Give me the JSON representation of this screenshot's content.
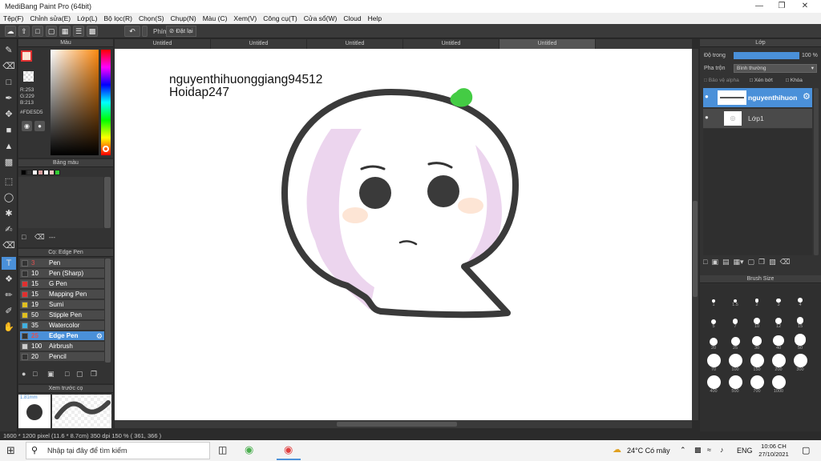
{
  "window": {
    "title": "MediBang Paint Pro (64bit)"
  },
  "menu": [
    "Tệp(F)",
    "Chỉnh sửa(E)",
    "Lớp(L)",
    "Bộ lọc(R)",
    "Chọn(S)",
    "Chụp(N)",
    "Màu (C)",
    "Xem(V)",
    "Công cụ(T)",
    "Cửa sổ(W)",
    "Cloud",
    "Help"
  ],
  "toolbar": {
    "key_label": "Phím",
    "reset_label": "Đặt lại"
  },
  "color_panel": {
    "title": "Màu",
    "r": "R:253",
    "g": "G:229",
    "b": "B:213",
    "hex": "#FDE5D5",
    "main_color": "#fde5d5"
  },
  "palette_panel": {
    "title": "Bảng màu",
    "swatches": [
      "#000000",
      "#333333",
      "#ffffff",
      "#d9a0a0",
      "#ffffff",
      "#f2c0c0",
      "#33cc33"
    ],
    "empty": "---"
  },
  "brush_panel": {
    "title": "Cọ: Edge Pen",
    "items": [
      {
        "size": "3",
        "name": "Pen",
        "color": "#333333"
      },
      {
        "size": "10",
        "name": "Pen (Sharp)",
        "color": "#333333"
      },
      {
        "size": "15",
        "name": "G Pen",
        "color": "#e03030"
      },
      {
        "size": "15",
        "name": "Mapping Pen",
        "color": "#e03030"
      },
      {
        "size": "19",
        "name": "Sumi",
        "color": "#e0c020"
      },
      {
        "size": "50",
        "name": "Stipple Pen",
        "color": "#e0c020"
      },
      {
        "size": "35",
        "name": "Watercolor",
        "color": "#40b0e0"
      },
      {
        "size": "25",
        "name": "Edge Pen",
        "color": "#333333"
      },
      {
        "size": "100",
        "name": "Airbrush",
        "color": "#cccccc"
      },
      {
        "size": "20",
        "name": "Pencil",
        "color": "#333333"
      }
    ]
  },
  "preview_panel": {
    "title": "Xem trước cọ",
    "size": "1.81mm"
  },
  "tabs": [
    "Untitled",
    "Untitled",
    "Untitled",
    "Untitled",
    "Untitled"
  ],
  "canvas": {
    "text_line1": "nguyenthihuonggiang94512",
    "text_line2": "Hoidap247"
  },
  "layer_panel": {
    "title": "Lớp",
    "opacity_label": "Độ trong",
    "opacity_value": "100 %",
    "opacity_fraction": 1.0,
    "blend_label": "Pha trộn",
    "blend_value": "Bình thường",
    "protect_alpha": "Bảo vệ alpha",
    "clip": "Xén bớt",
    "lock": "Khóa",
    "layers": [
      {
        "name": "nguyenthihuon",
        "selected": true
      },
      {
        "name": "Lớp1",
        "selected": false
      }
    ]
  },
  "brush_size_panel": {
    "title": "Brush Size",
    "sizes": [
      "1",
      "1.5",
      "2",
      "3",
      "4",
      "5",
      "7",
      "10",
      "12",
      "15",
      "20",
      "25",
      "30",
      "40",
      "50",
      "70",
      "100",
      "150",
      "200",
      "300",
      "400",
      "500",
      "700",
      "1000"
    ]
  },
  "status": {
    "text": "1600 * 1200 pixel   (11.6 * 8.7cm)   350 dpi   150 %   ( 361, 366 )"
  },
  "taskbar": {
    "search_placeholder": "Nhập tại đây để tìm kiếm",
    "weather": "24°C  Có mây",
    "lang": "ENG",
    "time": "10:06 CH",
    "date": "27/10/2021"
  }
}
